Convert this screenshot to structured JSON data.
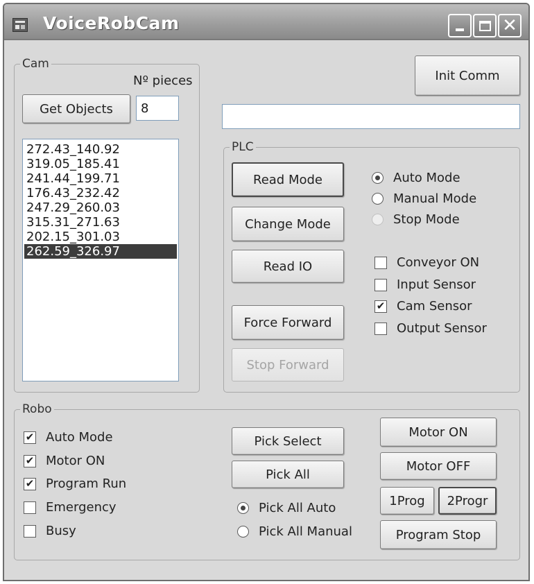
{
  "window": {
    "title": "VoiceRobCam",
    "icons": {
      "app": "app-icon",
      "minimize": "minimize-icon",
      "maximize": "maximize-icon",
      "close": "close-icon"
    }
  },
  "cam": {
    "group_label": "Cam",
    "pieces_label": "Nº pieces",
    "pieces_value": "8",
    "get_objects_label": "Get Objects",
    "objects": [
      "272.43_140.92",
      "319.05_185.41",
      "241.44_199.71",
      "176.43_232.42",
      "247.29_260.03",
      "315.31_271.63",
      "202.15_301.03",
      "262.59_326.97"
    ],
    "selected_index": 7
  },
  "comm": {
    "init_label": "Init Comm",
    "status_value": ""
  },
  "plc": {
    "group_label": "PLC",
    "buttons": {
      "read_mode": "Read Mode",
      "change_mode": "Change Mode",
      "read_io": "Read IO",
      "force_forward": "Force Forward",
      "stop_forward": "Stop Forward"
    },
    "modes": [
      {
        "label": "Auto Mode",
        "checked": true,
        "enabled": true
      },
      {
        "label": "Manual Mode",
        "checked": false,
        "enabled": true
      },
      {
        "label": "Stop Mode",
        "checked": false,
        "enabled": false
      }
    ],
    "sensors": [
      {
        "label": "Conveyor ON",
        "checked": false
      },
      {
        "label": "Input Sensor",
        "checked": false
      },
      {
        "label": "Cam Sensor",
        "checked": true
      },
      {
        "label": "Output Sensor",
        "checked": false
      }
    ]
  },
  "robo": {
    "group_label": "Robo",
    "status": [
      {
        "label": "Auto Mode",
        "checked": true
      },
      {
        "label": "Motor ON",
        "checked": true
      },
      {
        "label": "Program Run",
        "checked": true
      },
      {
        "label": "Emergency",
        "checked": false
      },
      {
        "label": "Busy",
        "checked": false
      }
    ],
    "pick_select_label": "Pick Select",
    "pick_all_label": "Pick All",
    "pick_modes": [
      {
        "label": "Pick All Auto",
        "checked": true
      },
      {
        "label": "Pick All Manual",
        "checked": false
      }
    ],
    "motor_on_label": "Motor ON",
    "motor_off_label": "Motor OFF",
    "prog1_label": "1Prog",
    "prog2_label": "2Progr",
    "program_stop_label": "Program Stop"
  }
}
